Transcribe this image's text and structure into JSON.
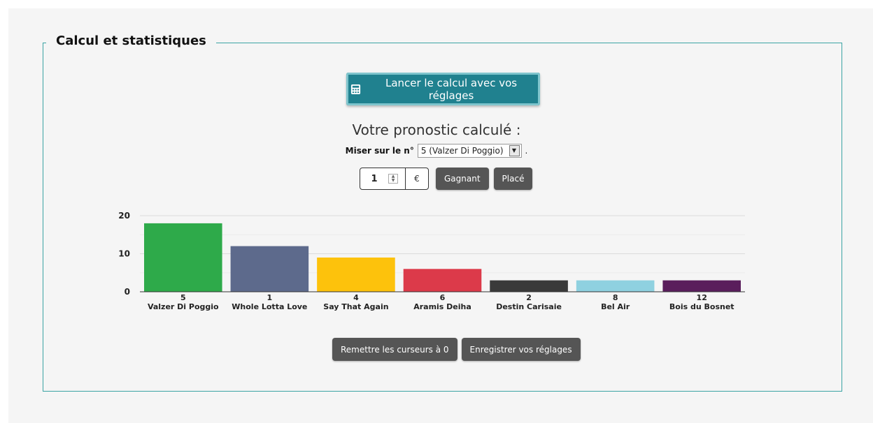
{
  "section": {
    "title": "Calcul et statistiques"
  },
  "calc_button": {
    "label": "Lancer le calcul avec vos réglages",
    "icon": "calculator-icon"
  },
  "pronostic": {
    "heading": "Votre pronostic calculé :"
  },
  "miser": {
    "label": "Miser sur le n°",
    "selected": "5 (Valzer Di Poggio)",
    "suffix": "."
  },
  "stake": {
    "value": "1",
    "currency": "€",
    "gagnant_label": "Gagnant",
    "place_label": "Placé"
  },
  "chart_data": {
    "type": "bar",
    "categories": [
      "5",
      "1",
      "4",
      "6",
      "2",
      "8",
      "12"
    ],
    "names": [
      "Valzer Di Poggio",
      "Whole Lotta Love",
      "Say That Again",
      "Aramis Deiha",
      "Destin Carisaie",
      "Bel Air",
      "Bois du Bosnet"
    ],
    "values": [
      18,
      12,
      9,
      6,
      3,
      3,
      3
    ],
    "colors": [
      "#2eaa4a",
      "#5d6a8c",
      "#fdc20c",
      "#dc3a4a",
      "#3a3a3a",
      "#8fd1e0",
      "#5a1e5c"
    ],
    "yticks": [
      "0",
      "10",
      "20"
    ],
    "ylim": [
      0,
      20
    ],
    "grid": true
  },
  "bottom": {
    "reset_label": "Remettre les curseurs à 0",
    "save_label": "Enregistrer vos réglages"
  }
}
